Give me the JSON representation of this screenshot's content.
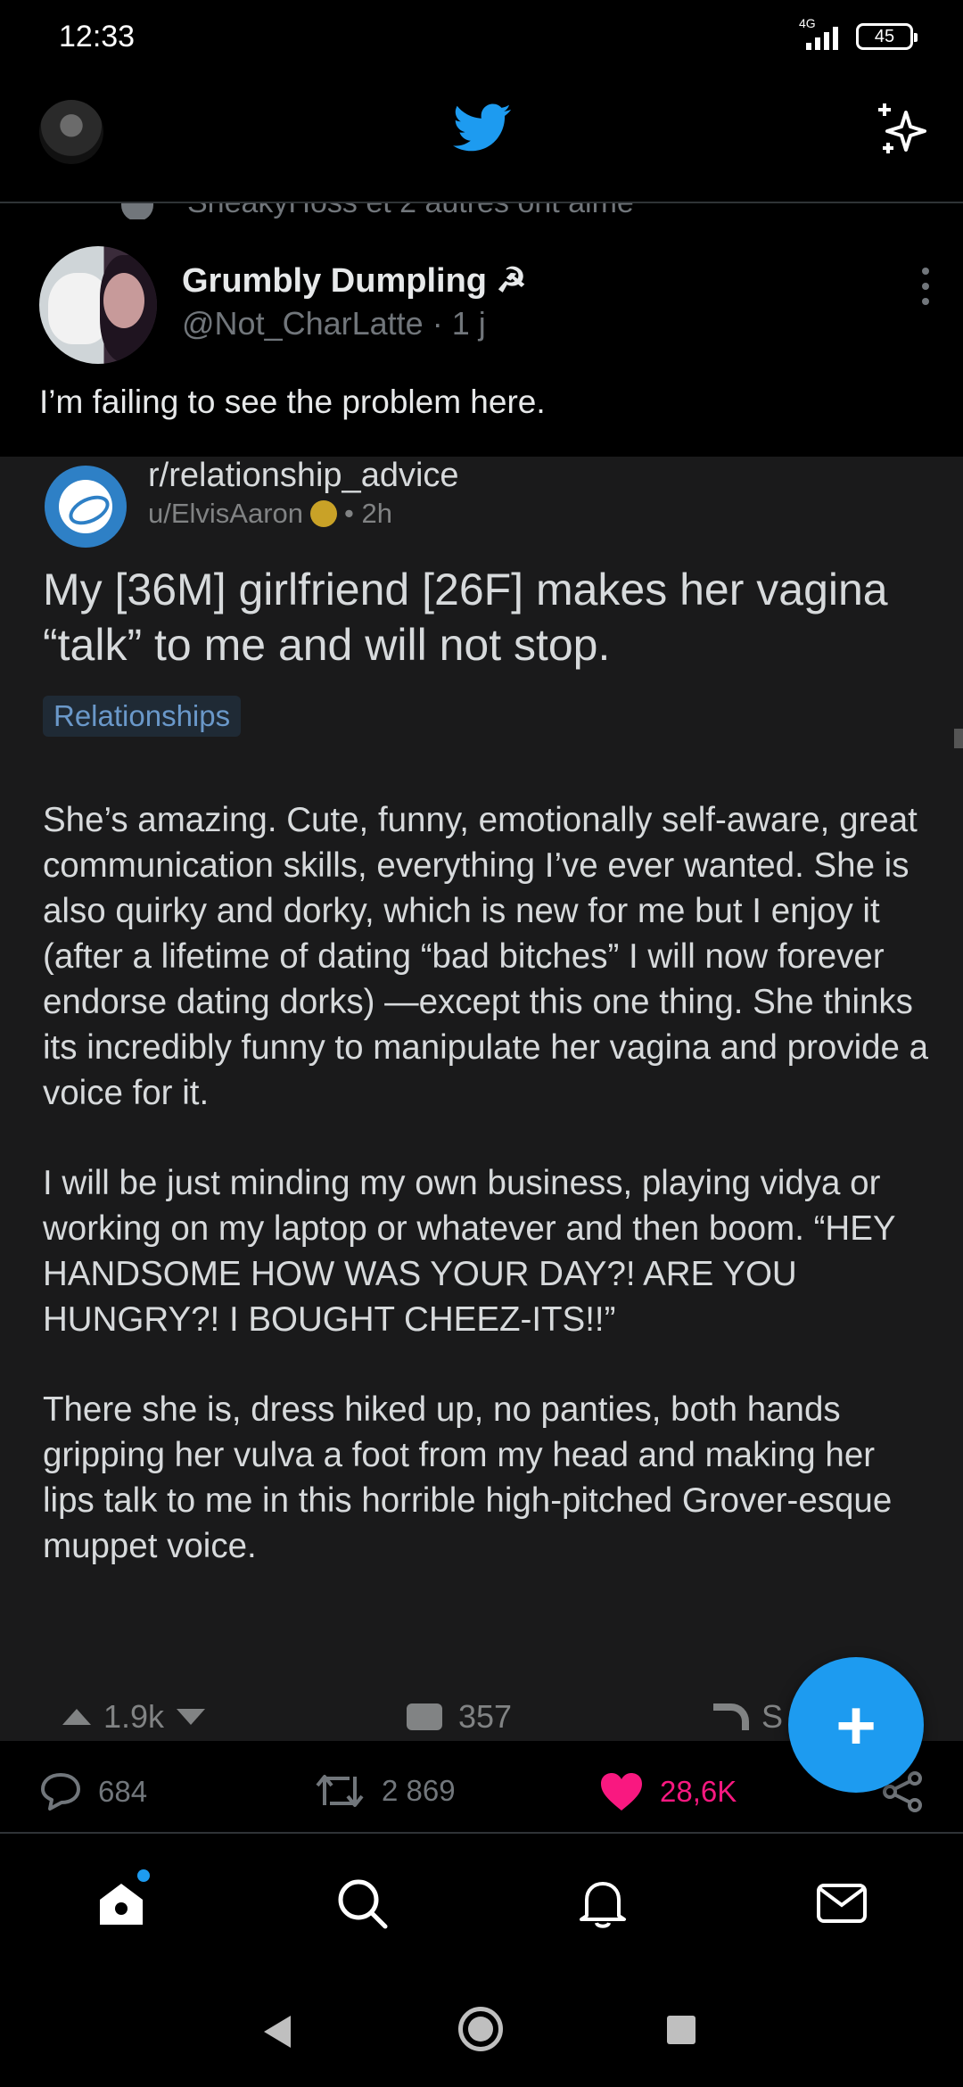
{
  "status_bar": {
    "time": "12:33",
    "network": "4G",
    "battery": "45"
  },
  "top_bar": {
    "logo_icon": "twitter-bird-icon",
    "sparkle_icon": "sparkle-icon"
  },
  "colors": {
    "accent": "#1d9bf0",
    "like": "#f91880",
    "background": "#000000",
    "muted": "#71767b"
  },
  "cutoff_line": {
    "text": "SneakyHoss et 2 autres ont aimé"
  },
  "tweet": {
    "display_name": "Grumbly Dumpling ☭",
    "handle": "@Not_CharLatte",
    "separator": "·",
    "time": "1 j",
    "text": "I’m failing to see the problem here.",
    "counts": {
      "replies": "684",
      "retweets": "2 869",
      "likes": "28,6K"
    }
  },
  "embedded_post": {
    "subreddit": "r/relationship_advice",
    "user": "u/ElvisAaron",
    "age": "• 2h",
    "title": "My [36M] girlfriend [26F] makes her vagina “talk” to me and will not stop.",
    "flair": "Relationships",
    "paragraphs": [
      "She’s amazing. Cute, funny, emotionally self-aware, great communication skills, everything I’ve ever wanted. She is also quirky and dorky, which is new for me but I enjoy it (after a lifetime of dating “bad bitches” I will now forever endorse dating dorks) —except this one thing. She thinks its incredibly funny to manipulate her vagina and provide a voice for it.",
      "I will be just minding my own business, playing vidya or working on my laptop or whatever and then boom. “HEY HANDSOME HOW WAS YOUR DAY?! ARE YOU HUNGRY?! I BOUGHT CHEEZ-ITS!!”",
      "There she is, dress hiked up, no panties, both hands gripping her vulva a foot from my head and making her lips talk to me in this horrible high-pitched Grover-esque muppet voice."
    ],
    "votes": "1.9k",
    "comments": "357",
    "share_label": "S"
  },
  "fab": {
    "label": "+"
  },
  "bottom_nav": {
    "items": [
      "home-icon",
      "search-icon",
      "bell-icon",
      "mail-icon"
    ]
  }
}
